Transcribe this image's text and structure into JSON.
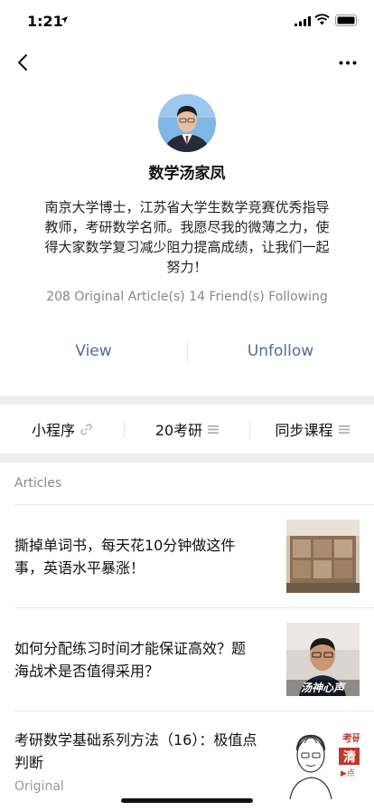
{
  "status": {
    "time": "1:21"
  },
  "profile": {
    "name": "数学汤家凤",
    "bio": "南京大学博士，江苏省大学生数学竞赛优秀指导教师，考研数学名师。我愿尽我的微薄之力，使得大家数学复习减少阻力提高成绩，让我们一起努力！",
    "stats": "208 Original Article(s)  14 Friend(s) Following"
  },
  "actions": {
    "view": "View",
    "unfollow": "Unfollow"
  },
  "menu": [
    {
      "label": "小程序",
      "icon": "link-icon"
    },
    {
      "label": "20考研",
      "icon": "menu-lines-icon"
    },
    {
      "label": "同步课程",
      "icon": "menu-lines-icon"
    }
  ],
  "articles_header": "Articles",
  "articles": [
    {
      "title": "撕掉单词书，每天花10分钟做这件事，英语水平暴涨！",
      "thumb": "bookshelf-photo"
    },
    {
      "title": "如何分配练习时间才能保证高效？题海战术是否值得采用？",
      "thumb": "teacher-photo",
      "thumb_caption": "汤神心声"
    },
    {
      "title": "考研数学基础系列方法（16）：极值点判断",
      "thumb": "teacher-sketch",
      "thumb_caption_top": "考研",
      "thumb_caption_red": "清",
      "thumb_caption_small": "▶点",
      "sub": "Original"
    }
  ],
  "colors": {
    "link_blue": "#576b95",
    "band_gray": "#ededed"
  }
}
